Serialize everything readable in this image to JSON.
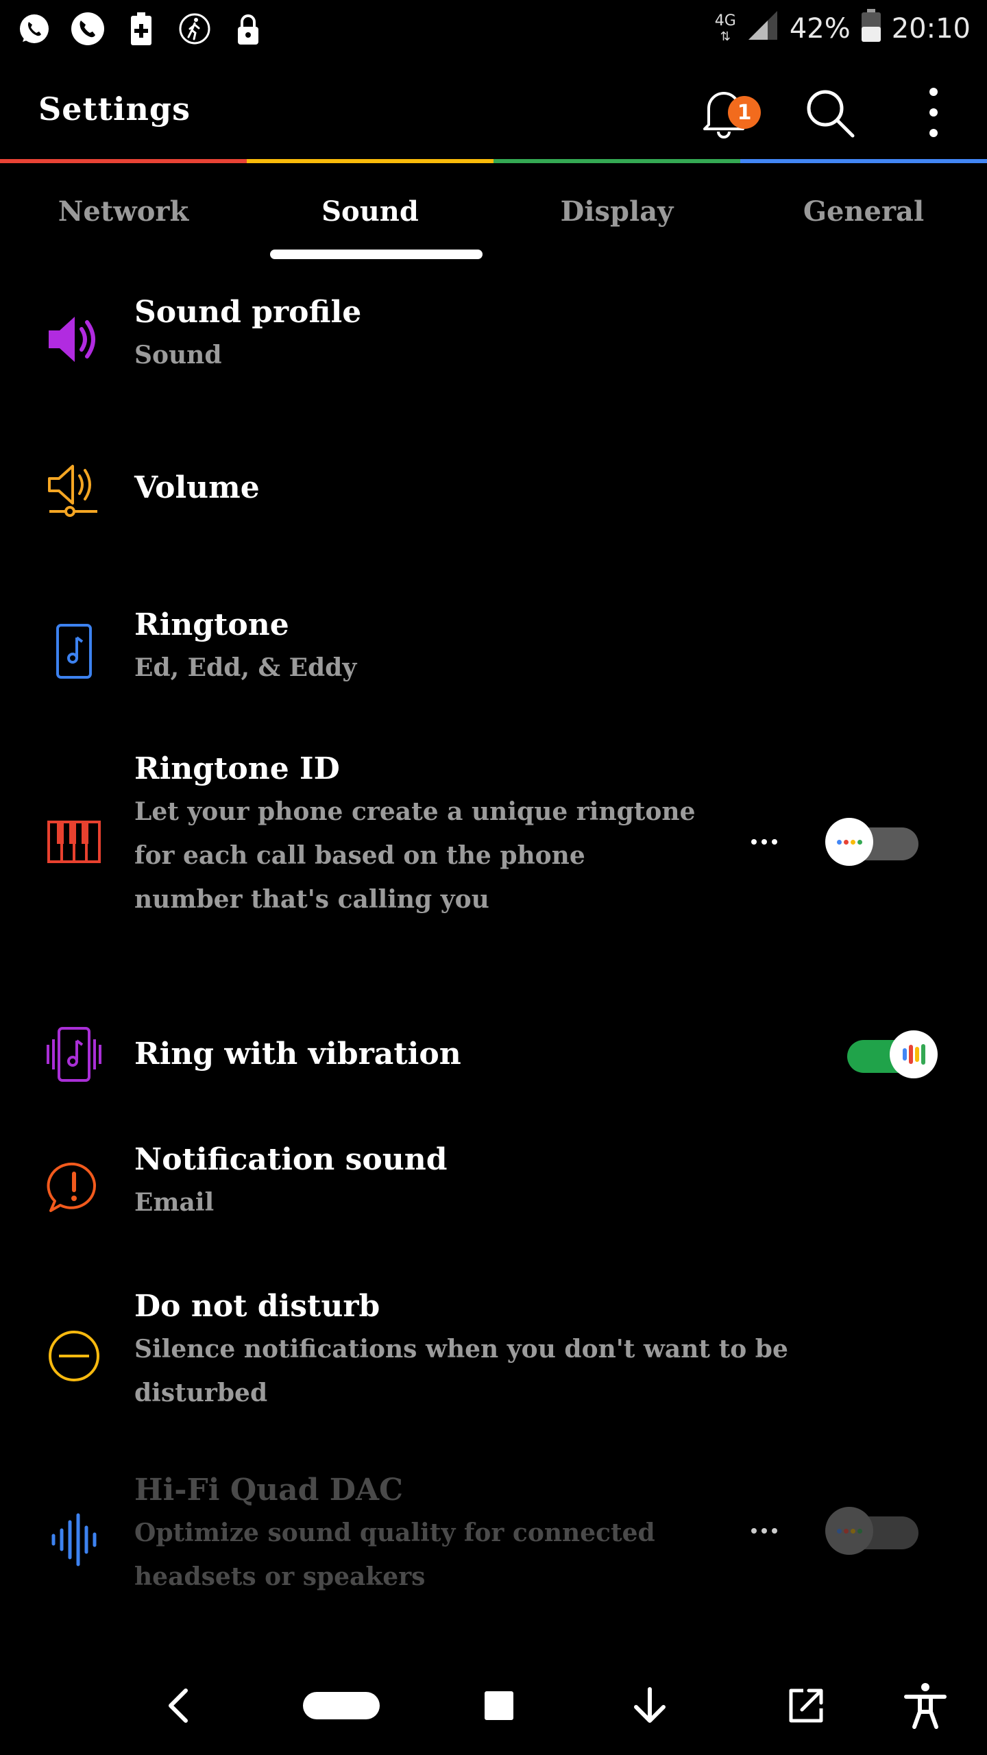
{
  "status_bar": {
    "left_icons": [
      "whatsapp-icon",
      "phone-call-icon",
      "battery-plus-icon",
      "walking-person-icon",
      "lock-icon"
    ],
    "network_type": "4G",
    "battery_percent": "42%",
    "time": "20:10"
  },
  "header": {
    "title": "Settings",
    "notification_count": "1"
  },
  "colors": {
    "rainbow": [
      "#e84335",
      "#f9bb0a",
      "#34a853",
      "#4286f5"
    ],
    "toggle_on": "#20a34a",
    "badge": "#f26b1d"
  },
  "tabs": [
    {
      "label": "Network",
      "active": false
    },
    {
      "label": "Sound",
      "active": true
    },
    {
      "label": "Display",
      "active": false
    },
    {
      "label": "General",
      "active": false
    }
  ],
  "settings": [
    {
      "id": "sound-profile",
      "icon": "speaker-icon",
      "icon_color": "#b12be0",
      "title": "Sound profile",
      "subtitle": "Sound"
    },
    {
      "id": "volume",
      "icon": "volume-icon",
      "icon_color": "#f5a623",
      "title": "Volume"
    },
    {
      "id": "ringtone",
      "icon": "music-note-phone-icon",
      "icon_color": "#3d82f0",
      "title": "Ringtone",
      "subtitle": "Ed, Edd, & Eddy"
    },
    {
      "id": "ringtone-id",
      "icon": "piano-icon",
      "icon_color": "#e8412f",
      "title": "Ringtone ID",
      "subtitle_lines": [
        "Let your phone create a unique ringtone",
        "for each call based on the phone",
        "number that's calling you"
      ],
      "toggle": false
    },
    {
      "id": "ring-vibration",
      "icon": "vibrate-music-icon",
      "icon_color": "#a92fd6",
      "title": "Ring with vibration",
      "toggle": true
    },
    {
      "id": "notification-sound",
      "icon": "alert-bubble-icon",
      "icon_color": "#f25a1d",
      "title": "Notification sound",
      "subtitle": "Email"
    },
    {
      "id": "do-not-disturb",
      "icon": "minus-circle-icon",
      "icon_color": "#f7b90f",
      "title": "Do not disturb",
      "subtitle_lines": [
        "Silence notifications when you don't want to be",
        "disturbed"
      ]
    },
    {
      "id": "hifi-dac",
      "icon": "sound-wave-icon",
      "icon_color": "#3d82f0",
      "title": "Hi-Fi Quad DAC",
      "subtitle_lines": [
        "Optimize sound quality for connected",
        "headsets or speakers"
      ],
      "toggle": false,
      "disabled": true
    }
  ],
  "nav_icons": [
    "back-icon",
    "home-pill-icon",
    "recents-icon",
    "down-arrow-icon",
    "share-icon",
    "accessibility-icon"
  ]
}
